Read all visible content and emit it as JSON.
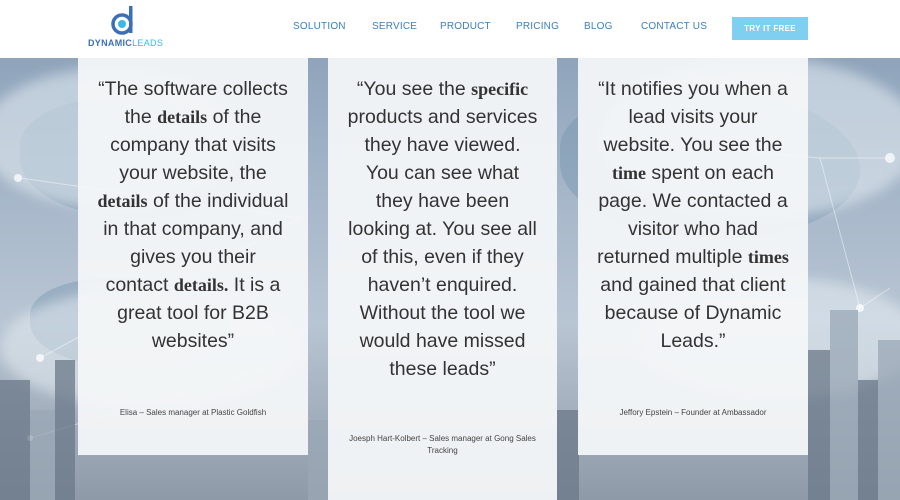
{
  "header": {
    "logo": {
      "brand": "DYNAMIC",
      "brand_suffix": "LEADS"
    },
    "nav": [
      {
        "label": "SOLUTION"
      },
      {
        "label": "SERVICE"
      },
      {
        "label": "PRODUCT"
      },
      {
        "label": "PRICING"
      },
      {
        "label": "BLOG"
      },
      {
        "label": "CONTACT US"
      }
    ],
    "cta_label": "TRY IT FREE"
  },
  "testimonials": [
    {
      "quote_parts": [
        "“The software collects the ",
        "details",
        " of the company that visits your website, the ",
        "details",
        " of the individual in that company, and gives you their contact ",
        "details.",
        " It is a great tool for B2B websites”"
      ],
      "author": "Elisa – Sales manager at Plastic Goldfish"
    },
    {
      "quote_parts": [
        "“You see the ",
        "specific",
        " products and services they have viewed. You can see what they have been looking at. You see all of this, even if they haven’t enquired. Without the tool we would have missed these leads”"
      ],
      "author": "Joesph Hart-Kolbert – Sales manager at Gong Sales Tracking"
    },
    {
      "quote_parts": [
        "“It notifies you when a lead visits your website. You see the ",
        "time",
        " spent on each page. We contacted a visitor who had returned multiple ",
        "times",
        " and gained that client because of Dynamic Leads.”"
      ],
      "author": "Jeffory Epstein  – Founder at Ambassador"
    }
  ],
  "colors": {
    "nav": "#3a7fc0",
    "cta_bg": "#7fd0f0",
    "logo_primary": "#3d6fb6",
    "logo_accent": "#3db7e4"
  }
}
